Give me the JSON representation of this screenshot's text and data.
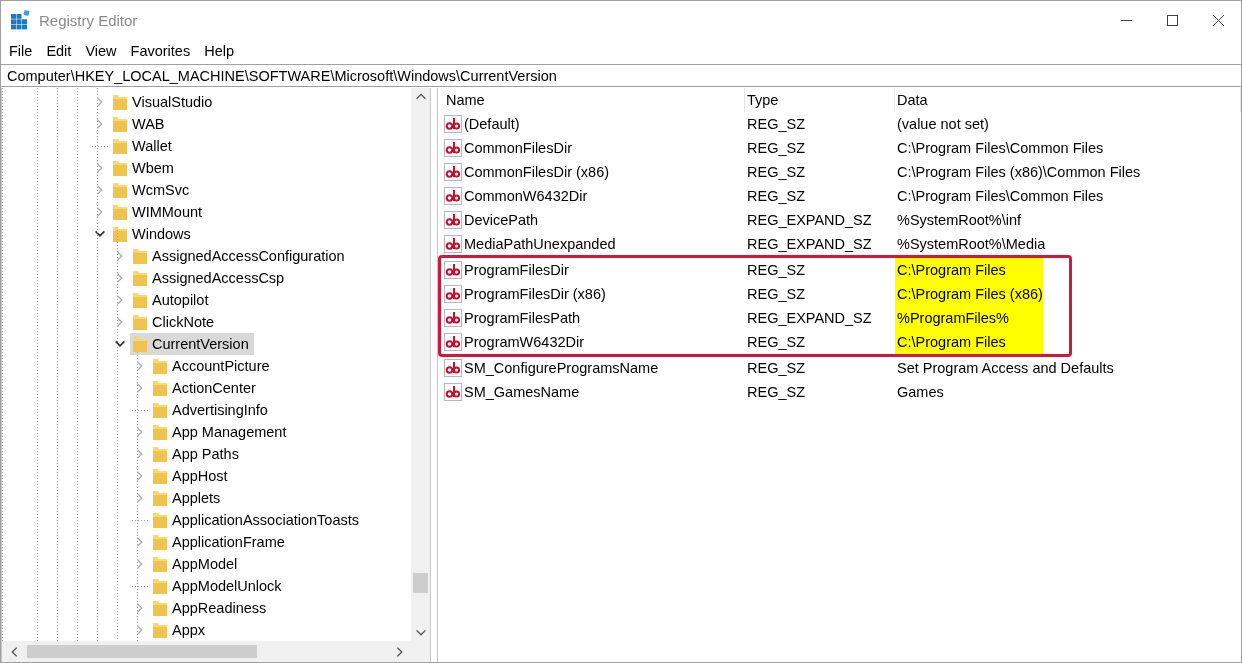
{
  "window": {
    "title": "Registry Editor"
  },
  "menu": [
    "File",
    "Edit",
    "View",
    "Favorites",
    "Help"
  ],
  "address": "Computer\\HKEY_LOCAL_MACHINE\\SOFTWARE\\Microsoft\\Windows\\CurrentVersion",
  "tree": [
    {
      "label": "VisualStudio",
      "kind": "collapsed",
      "selected": false
    },
    {
      "label": "WAB",
      "kind": "collapsed",
      "selected": false
    },
    {
      "label": "Wallet",
      "kind": "leaf",
      "selected": false
    },
    {
      "label": "Wbem",
      "kind": "collapsed",
      "selected": false
    },
    {
      "label": "WcmSvc",
      "kind": "collapsed",
      "selected": false
    },
    {
      "label": "WIMMount",
      "kind": "collapsed",
      "selected": false
    },
    {
      "label": "Windows",
      "kind": "expanded",
      "selected": false,
      "children": [
        {
          "label": "AssignedAccessConfiguration",
          "kind": "collapsed",
          "selected": false
        },
        {
          "label": "AssignedAccessCsp",
          "kind": "collapsed",
          "selected": false
        },
        {
          "label": "Autopilot",
          "kind": "collapsed",
          "selected": false
        },
        {
          "label": "ClickNote",
          "kind": "collapsed",
          "selected": false
        },
        {
          "label": "CurrentVersion",
          "kind": "expanded",
          "selected": true,
          "children": [
            {
              "label": "AccountPicture",
              "kind": "collapsed",
              "selected": false
            },
            {
              "label": "ActionCenter",
              "kind": "collapsed",
              "selected": false
            },
            {
              "label": "AdvertisingInfo",
              "kind": "leaf",
              "selected": false
            },
            {
              "label": "App Management",
              "kind": "collapsed",
              "selected": false
            },
            {
              "label": "App Paths",
              "kind": "collapsed",
              "selected": false
            },
            {
              "label": "AppHost",
              "kind": "collapsed",
              "selected": false
            },
            {
              "label": "Applets",
              "kind": "collapsed",
              "selected": false
            },
            {
              "label": "ApplicationAssociationToasts",
              "kind": "leaf",
              "selected": false
            },
            {
              "label": "ApplicationFrame",
              "kind": "collapsed",
              "selected": false
            },
            {
              "label": "AppModel",
              "kind": "collapsed",
              "selected": false
            },
            {
              "label": "AppModelUnlock",
              "kind": "leaf",
              "selected": false
            },
            {
              "label": "AppReadiness",
              "kind": "collapsed",
              "selected": false
            },
            {
              "label": "Appx",
              "kind": "collapsed",
              "selected": false
            }
          ]
        }
      ]
    }
  ],
  "table": {
    "columns": [
      "Name",
      "Type",
      "Data"
    ],
    "rows": [
      {
        "name": "(Default)",
        "type": "REG_SZ",
        "data": "(value not set)",
        "boxed": false,
        "highlighted": false
      },
      {
        "name": "CommonFilesDir",
        "type": "REG_SZ",
        "data": "C:\\Program Files\\Common Files",
        "boxed": false,
        "highlighted": false
      },
      {
        "name": "CommonFilesDir (x86)",
        "type": "REG_SZ",
        "data": "C:\\Program Files (x86)\\Common Files",
        "boxed": false,
        "highlighted": false
      },
      {
        "name": "CommonW6432Dir",
        "type": "REG_SZ",
        "data": "C:\\Program Files\\Common Files",
        "boxed": false,
        "highlighted": false
      },
      {
        "name": "DevicePath",
        "type": "REG_EXPAND_SZ",
        "data": "%SystemRoot%\\inf",
        "boxed": false,
        "highlighted": false
      },
      {
        "name": "MediaPathUnexpanded",
        "type": "REG_EXPAND_SZ",
        "data": "%SystemRoot%\\Media",
        "boxed": false,
        "highlighted": false
      },
      {
        "name": "ProgramFilesDir",
        "type": "REG_SZ",
        "data": "C:\\Program Files",
        "boxed": true,
        "highlighted": true
      },
      {
        "name": "ProgramFilesDir (x86)",
        "type": "REG_SZ",
        "data": "C:\\Program Files (x86)",
        "boxed": true,
        "highlighted": true
      },
      {
        "name": "ProgramFilesPath",
        "type": "REG_EXPAND_SZ",
        "data": "%ProgramFiles%",
        "boxed": true,
        "highlighted": true
      },
      {
        "name": "ProgramW6432Dir",
        "type": "REG_SZ",
        "data": "C:\\Program Files",
        "boxed": true,
        "highlighted": true
      },
      {
        "name": "SM_ConfigureProgramsName",
        "type": "REG_SZ",
        "data": "Set Program Access and Defaults",
        "boxed": false,
        "highlighted": false
      },
      {
        "name": "SM_GamesName",
        "type": "REG_SZ",
        "data": "Games",
        "boxed": false,
        "highlighted": false
      }
    ]
  }
}
